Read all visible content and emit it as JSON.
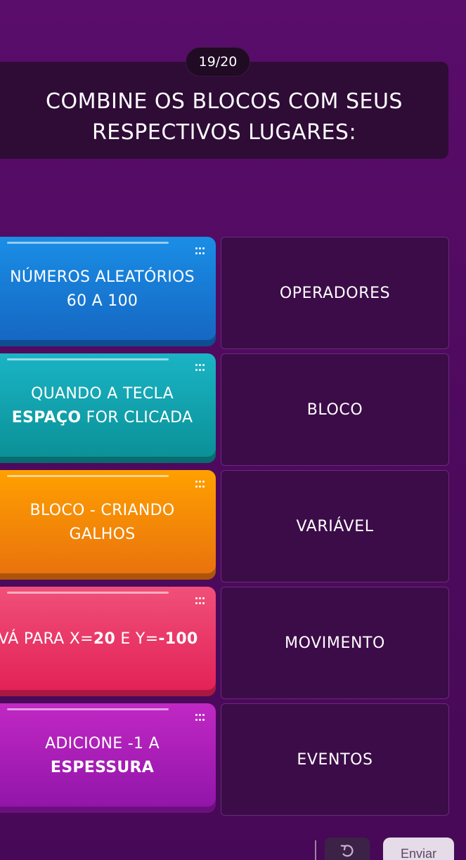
{
  "quiz": {
    "counter": "19/20",
    "question_line1": "COMBINE OS BLOCOS COM SEUS",
    "question_line2": "RESPECTIVOS LUGARES:"
  },
  "pairs": [
    {
      "color": "#1565c0",
      "block_line1": "NÚMEROS ALEATÓRIOS",
      "block_line2": "60 A 100",
      "target": "OPERADORES"
    },
    {
      "color": "#0a8f94",
      "block_line1": "QUANDO A TECLA",
      "block_line2_bold": "ESPAÇO",
      "block_line2_rest": " FOR CLICADA",
      "target": "BLOCO"
    },
    {
      "color": "#e8700e",
      "block_line1": "BLOCO - CRIANDO",
      "block_line2": "GALHOS",
      "target": "VARIÁVEL"
    },
    {
      "color": "#e21f56",
      "block_pre": "VÁ PARA X=",
      "block_bold1": "20",
      "block_mid": " E Y=",
      "block_bold2": "-100",
      "target": "MOVIMENTO"
    },
    {
      "color": "#8f14a8",
      "block_line1": "ADICIONE -1 A",
      "block_line2_bold": "ESPESSURA",
      "target": "EVENTOS"
    }
  ],
  "footer": {
    "undo_icon": "undo-icon",
    "send_label": "Enviar"
  }
}
